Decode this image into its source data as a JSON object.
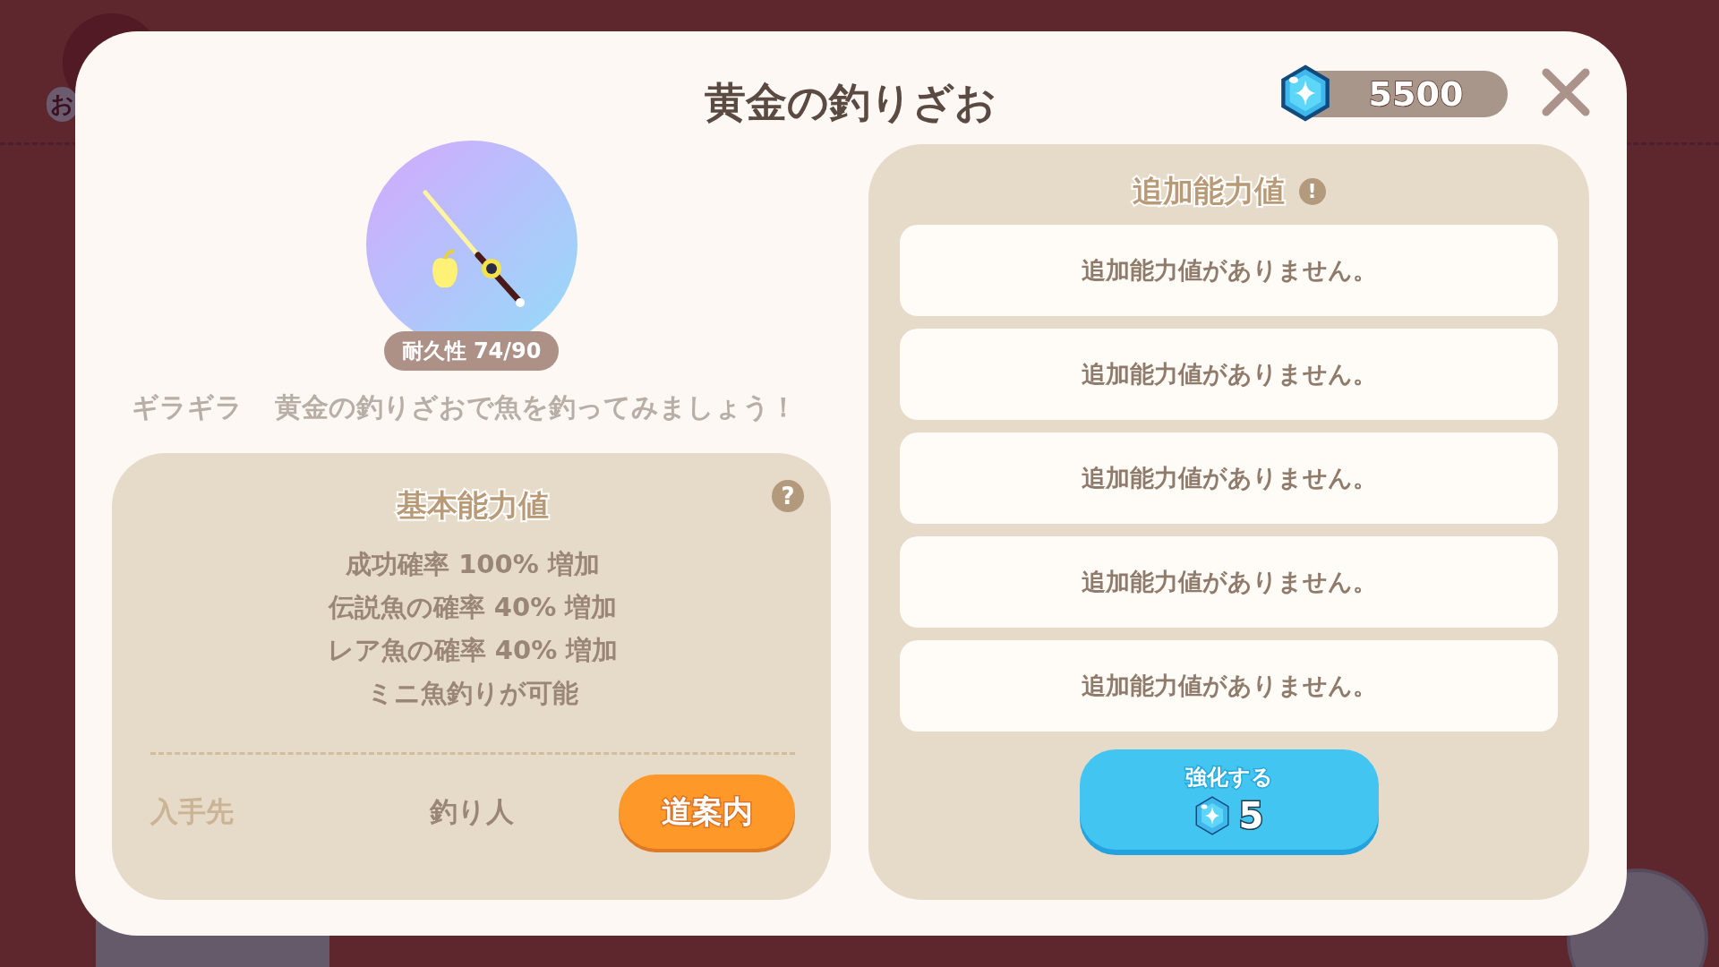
{
  "background": {
    "badge": "お"
  },
  "dialog": {
    "title": "黄金の釣りざお",
    "gems": "5500"
  },
  "item": {
    "durability": "耐久性 74/90",
    "tag": "ギラギラ",
    "description": "黄金の釣りざおで魚を釣ってみましょう！"
  },
  "base_stats": {
    "title": "基本能力値",
    "help_icon": "?",
    "lines": [
      "成功確率 100% 増加",
      "伝説魚の確率 40% 増加",
      "レア魚の確率 40% 増加",
      "ミニ魚釣りが可能"
    ],
    "source_label": "入手先",
    "source": "釣り人",
    "guide_button": "道案内"
  },
  "extra_stats": {
    "title": "追加能力値",
    "info_icon": "!",
    "slots": [
      "追加能力値がありません。",
      "追加能力値がありません。",
      "追加能力値がありません。",
      "追加能力値がありません。",
      "追加能力値がありません。"
    ],
    "upgrade_button": {
      "label": "強化する",
      "cost": "5"
    }
  }
}
